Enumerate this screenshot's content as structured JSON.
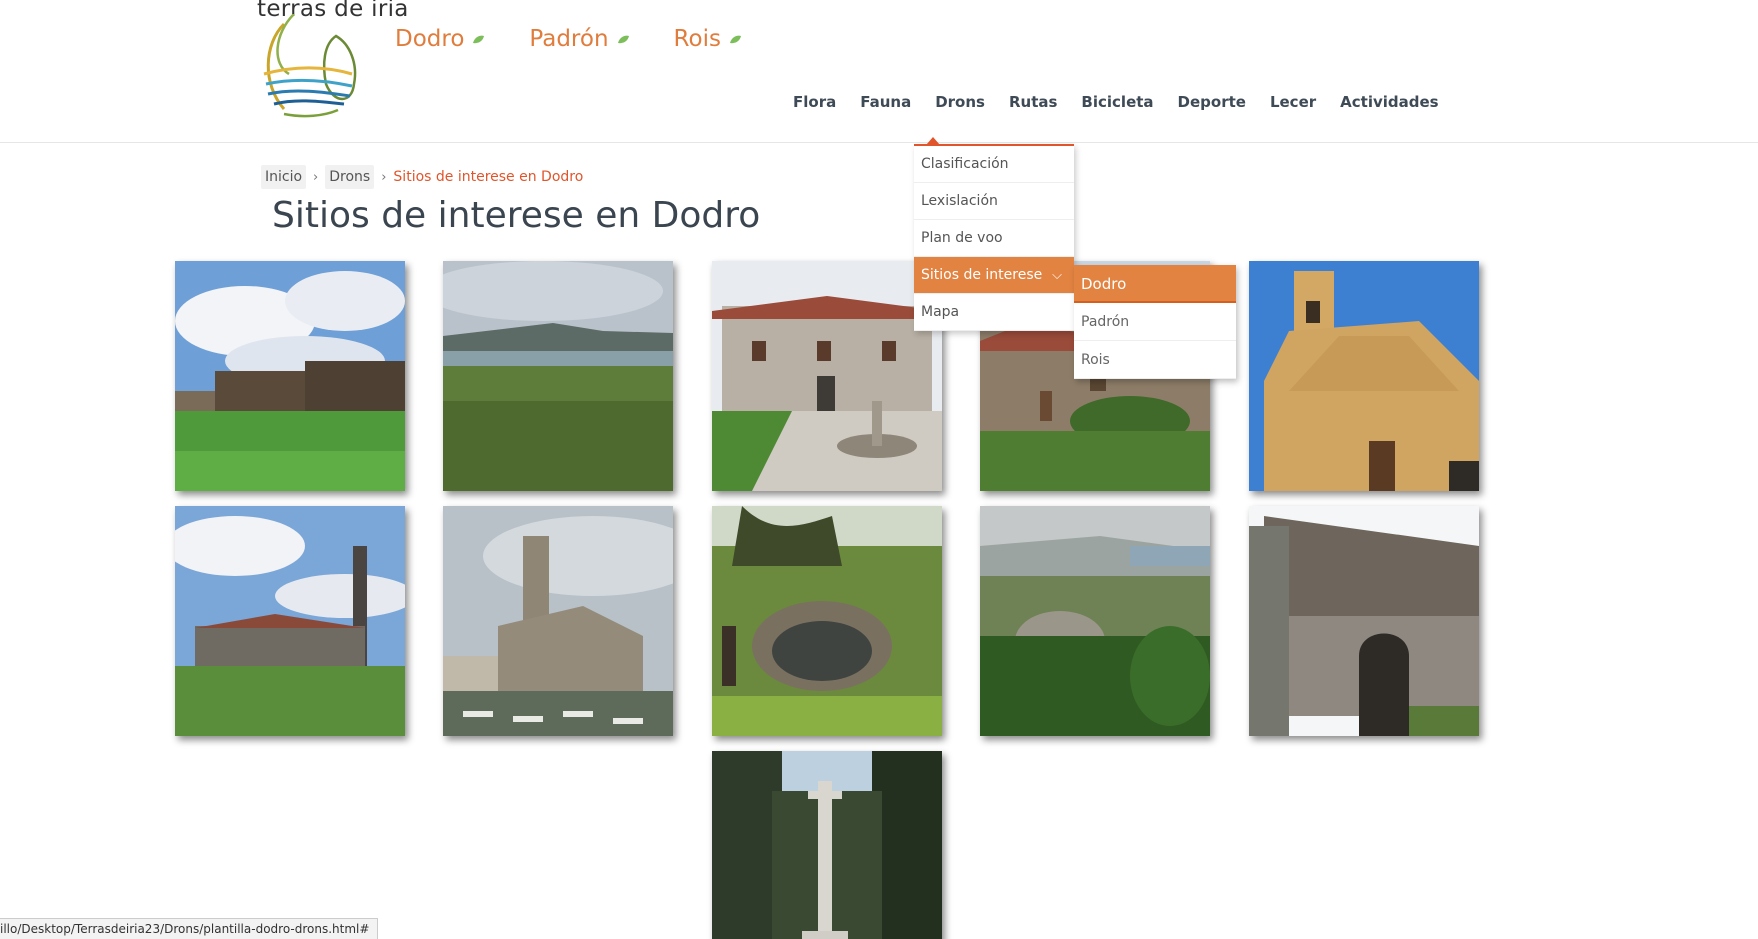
{
  "header": {
    "brand": "terras de iria",
    "towns": [
      "Dodro",
      "Padrón",
      "Rois"
    ],
    "nav": [
      "Flora",
      "Fauna",
      "Drons",
      "Rutas",
      "Bicicleta",
      "Deporte",
      "Lecer",
      "Actividades"
    ]
  },
  "breadcrumb": {
    "items": [
      "Inicio",
      "Drons"
    ],
    "current": "Sitios de interese en Dodro"
  },
  "page_title": "Sitios de interese en Dodro",
  "dropdown": {
    "items": [
      "Clasificación",
      "Lexislación",
      "Plan de voo",
      "Sitios de interese",
      "Mapa"
    ],
    "active_index": 3
  },
  "submenu": {
    "items": [
      "Dodro",
      "Padrón",
      "Rois"
    ],
    "active_index": 0
  },
  "gallery": {
    "count": 11,
    "tiles": [
      "horreos",
      "marsh-reeds",
      "pazo-fountain",
      "stone-manor",
      "church-yellow",
      "church-field",
      "church-cemetery",
      "stone-pool",
      "valley-view",
      "old-granary",
      "cruceiro"
    ]
  },
  "status_bar": "illo/Desktop/Terrasdeiria23/Drons/plantilla-dodro-drons.html#",
  "colors": {
    "accent_orange": "#e07d3c",
    "accent_red": "#e0552b",
    "nav_text": "#3e4a55"
  }
}
